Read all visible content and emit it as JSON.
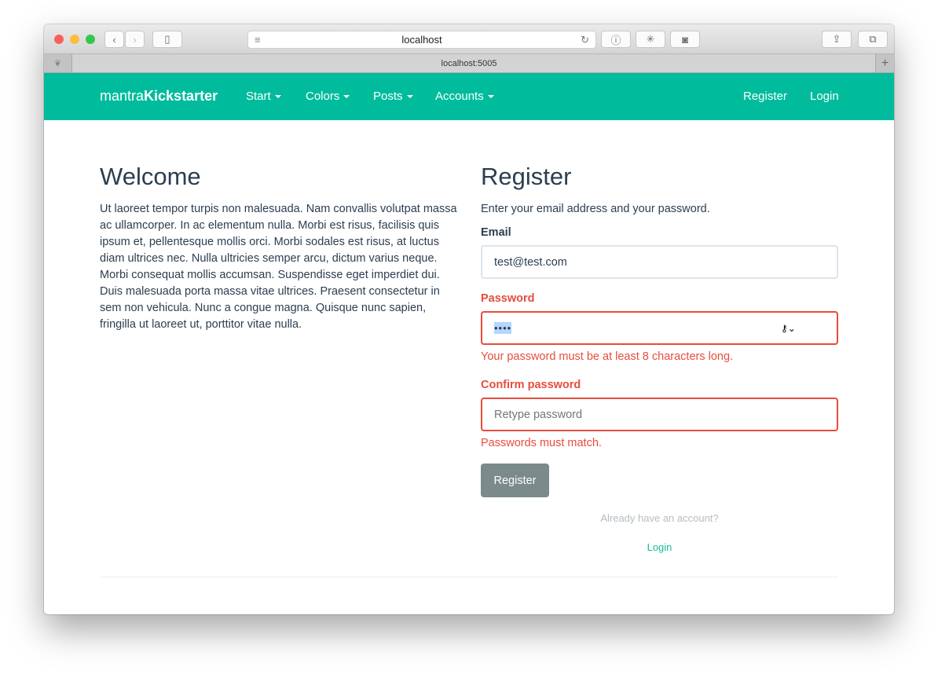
{
  "browser": {
    "address": "localhost",
    "tab_title": "localhost:5005",
    "colors": {
      "close": "#fc605c",
      "minimize": "#fdbc40",
      "zoom": "#34c84a"
    }
  },
  "navbar": {
    "brand_light": "mantra",
    "brand_bold": "Kickstarter",
    "items": [
      {
        "label": "Start"
      },
      {
        "label": "Colors"
      },
      {
        "label": "Posts"
      },
      {
        "label": "Accounts"
      }
    ],
    "right": [
      {
        "label": "Register"
      },
      {
        "label": "Login"
      }
    ],
    "color": "#00bc9c"
  },
  "welcome": {
    "title": "Welcome",
    "text": "Ut laoreet tempor turpis non malesuada. Nam convallis volutpat massa ac ullamcorper. In ac elementum nulla. Morbi est risus, facilisis quis ipsum et, pellentesque mollis orci. Morbi sodales est risus, at luctus diam ultrices nec. Nulla ultricies semper arcu, dictum varius neque. Morbi consequat mollis accumsan. Suspendisse eget imperdiet dui. Duis malesuada porta massa vitae ultrices. Praesent consectetur in sem non vehicula. Nunc a congue magna. Quisque nunc sapien, fringilla ut laoreet ut, porttitor vitae nulla."
  },
  "register": {
    "title": "Register",
    "subtitle": "Enter your email address and your password.",
    "email_label": "Email",
    "email_value": "test@test.com",
    "password_label": "Password",
    "password_value": "••••",
    "password_error": "Your password must be at least 8 characters long.",
    "confirm_label": "Confirm password",
    "confirm_placeholder": "Retype password",
    "confirm_error": "Passwords must match.",
    "submit": "Register",
    "already": "Already have an account?",
    "login_link": "Login",
    "error_color": "#e74c3c"
  }
}
